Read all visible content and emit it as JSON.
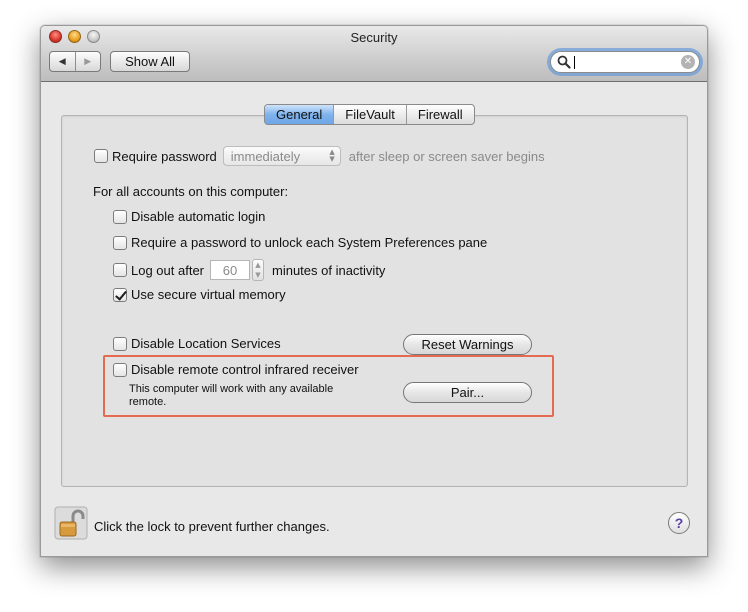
{
  "window": {
    "title": "Security"
  },
  "toolbar": {
    "back_glyph": "◀",
    "forward_glyph": "▶",
    "show_all_label": "Show All",
    "search_value": "",
    "search_clear_glyph": "✕"
  },
  "tabs": [
    {
      "label": "General",
      "active": true
    },
    {
      "label": "FileVault",
      "active": false
    },
    {
      "label": "Firewall",
      "active": false
    }
  ],
  "general": {
    "require_password": {
      "label": "Require password",
      "checked": false,
      "popup_value": "immediately",
      "popup_arrows": "▲\n▼",
      "suffix": "after sleep or screen saver begins"
    },
    "all_accounts_heading": "For all accounts on this computer:",
    "options": [
      {
        "label": "Disable automatic login",
        "checked": false
      },
      {
        "label": "Require a password to unlock each System Preferences pane",
        "checked": false
      }
    ],
    "logout": {
      "label": "Log out after",
      "checked": false,
      "minutes": "60",
      "stepper": "▲\n▼",
      "suffix": "minutes of inactivity"
    },
    "secure_vm": {
      "label": "Use secure virtual memory",
      "checked": true
    },
    "location": {
      "label": "Disable Location Services",
      "checked": false
    },
    "reset_warnings_label": "Reset Warnings",
    "remote": {
      "label": "Disable remote control infrared receiver",
      "checked": false,
      "help_text_line1": "This computer will work with any available",
      "help_text_line2": "remote.",
      "pair_label": "Pair..."
    }
  },
  "footer": {
    "lock_text": "Click the lock to prevent further changes.",
    "help_label": "?"
  },
  "colors": {
    "highlight": "#e46a52",
    "tab_active": "#7fb3ec",
    "search_focus": "#5d97db"
  }
}
